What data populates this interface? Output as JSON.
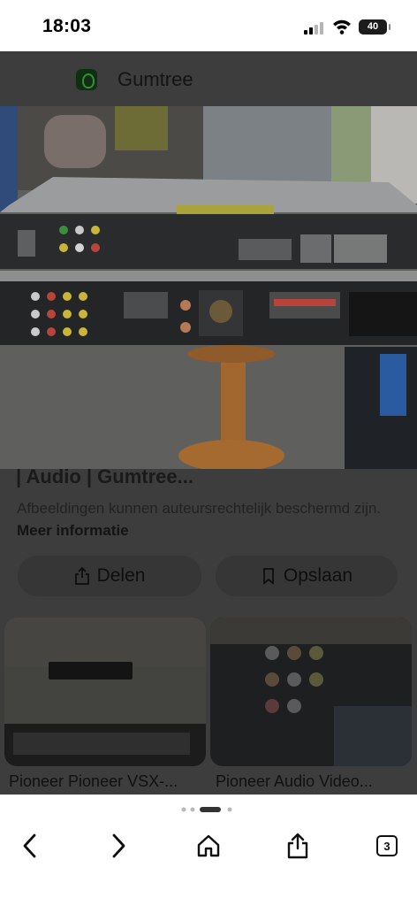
{
  "status_bar": {
    "time": "18:03",
    "battery": "40"
  },
  "site": {
    "name": "Gumtree",
    "logo_icon": "gumtree-leaf-icon"
  },
  "image_result": {
    "title": "| Audio | Gumtree...",
    "copyright_notice": "Afbeeldingen kunnen auteursrechtelijk beschermd zijn.",
    "more_info_link": "Meer informatie"
  },
  "actions": {
    "share_label": "Delen",
    "share_icon": "share-icon",
    "save_label": "Opslaan",
    "save_icon": "bookmark-icon"
  },
  "related": [
    {
      "caption": "Pioneer Pioneer VSX-..."
    },
    {
      "caption": "Pioneer Audio Video..."
    }
  ],
  "toolbar": {
    "back_icon": "chevron-left-icon",
    "forward_icon": "chevron-right-icon",
    "home_icon": "home-icon",
    "share_icon": "share-icon",
    "tabs_count": "3"
  },
  "colors": {
    "overlay": "#3d3d3d",
    "toolbar_bg": "#ffffff",
    "logo_green": "#3a8a3a"
  }
}
